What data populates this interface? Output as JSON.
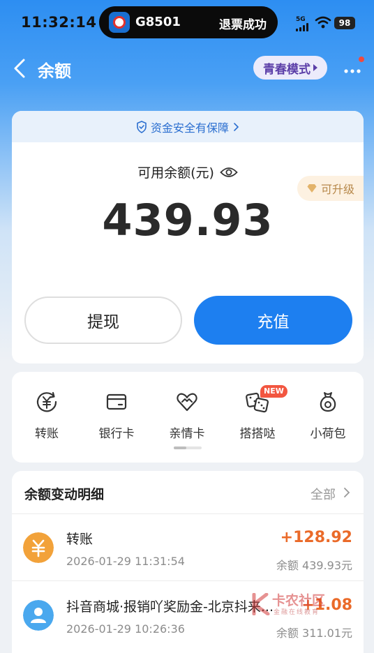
{
  "status_bar": {
    "time": "11:32:14",
    "island_train": "G8501",
    "island_status": "退票成功",
    "network": "5G",
    "battery": "98"
  },
  "nav": {
    "title": "余额",
    "youth_mode": "青春模式"
  },
  "balance_card": {
    "security_text": "资金安全有保障",
    "available_label": "可用余额(元)",
    "amount": "439.93",
    "upgrade_label": "可升级",
    "withdraw_label": "提现",
    "recharge_label": "充值"
  },
  "quick_actions": [
    {
      "label": "转账",
      "icon": "transfer-icon"
    },
    {
      "label": "银行卡",
      "icon": "bank-card-icon"
    },
    {
      "label": "亲情卡",
      "icon": "family-card-icon"
    },
    {
      "label": "搭搭哒",
      "icon": "dice-icon",
      "badge": "NEW"
    },
    {
      "label": "小荷包",
      "icon": "pouch-icon"
    }
  ],
  "transactions": {
    "title": "余额变动明细",
    "filter": "全部",
    "items": [
      {
        "name": "转账",
        "time": "2026-01-29 11:31:54",
        "amount": "+128.92",
        "balance": "余额 439.93元",
        "icon": "yuan-icon",
        "icon_color": "#f2a23a"
      },
      {
        "name": "抖音商城·报销吖奖励金-北京抖来...",
        "time": "2026-01-29 10:26:36",
        "amount": "+1.08",
        "balance": "余额 311.01元",
        "icon": "user-icon",
        "icon_color": "#4aa8ee"
      }
    ]
  },
  "watermark": {
    "main": "卡农社区",
    "sub": "金融在线教育"
  },
  "colors": {
    "primary": "#1d7ff0",
    "amount_positive": "#ea6a29",
    "youth_text": "#5b3ea8",
    "upgrade_text": "#b7884a"
  }
}
